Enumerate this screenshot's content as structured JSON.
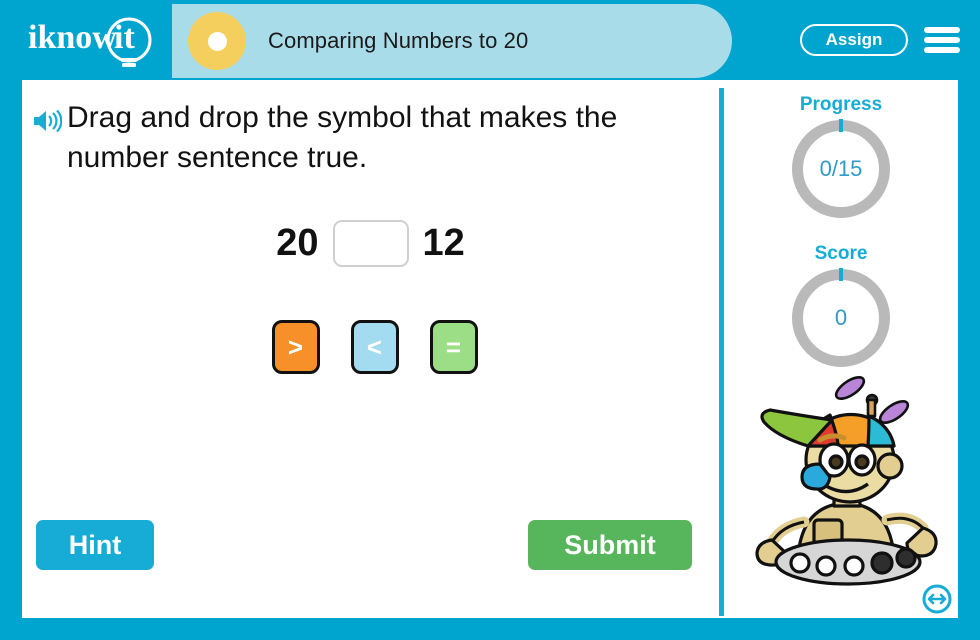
{
  "header": {
    "logo_text": "iknowit",
    "logo_icon": "lightbulb-icon",
    "lesson_title": "Comparing Numbers to 20",
    "assign_label": "Assign",
    "menu_icon": "hamburger-menu-icon",
    "title_dot_icon": "lesson-marker-dot",
    "bar_color": "#00A5CF",
    "banner_color": "#A8DCE8",
    "dot_color": "#F4CF5E"
  },
  "question": {
    "speaker_icon": "speaker-audio-icon",
    "instruction": "Drag and drop the symbol that makes the number sentence true.",
    "left_number": "20",
    "right_number": "12",
    "answer_slot_value": "",
    "symbols": [
      {
        "label": ">",
        "name": "greater-than",
        "color": "#F79029"
      },
      {
        "label": "<",
        "name": "less-than",
        "color": "#A3DCF0"
      },
      {
        "label": "=",
        "name": "equals",
        "color": "#9BDE86"
      }
    ],
    "hint_label": "Hint",
    "submit_label": "Submit",
    "hint_color": "#17ACD6",
    "submit_color": "#57B65B"
  },
  "status": {
    "progress_label": "Progress",
    "progress_value": "0/15",
    "score_label": "Score",
    "score_value": "0",
    "accent_color": "#17ACD6",
    "ring_color": "#B9B9B9",
    "mascot_icon": "robot-mascot-propeller-hat",
    "resize_icon": "resize-expand-icon"
  }
}
